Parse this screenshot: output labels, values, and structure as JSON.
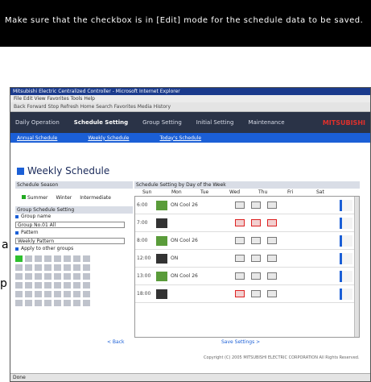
{
  "callout": {
    "text": "Make sure that the checkbox is in [Edit] mode for the schedule data to be saved."
  },
  "side_letters": [
    "a",
    "p"
  ],
  "window": {
    "title": "Mitsubishi Electric Centralized Controller - Microsoft Internet Explorer",
    "menubar": "File  Edit  View  Favorites  Tools  Help",
    "toolbar": "Back  Forward  Stop  Refresh  Home  Search  Favorites  Media  History"
  },
  "nav": {
    "items": [
      "Daily Operation",
      "Schedule Setting",
      "Group Setting",
      "Initial Setting",
      "Maintenance"
    ],
    "active": 1,
    "logo": "MITSUBISHI"
  },
  "subnav": {
    "links": [
      "Annual Schedule",
      "Weekly Schedule",
      "Today's Schedule"
    ]
  },
  "page_title": "Weekly Schedule",
  "left": {
    "season_header": "Schedule Season",
    "options": [
      "Summer",
      "Winter",
      "Intermediate"
    ],
    "group_header": "Group Schedule Setting",
    "group_label": "Group name",
    "group_value": "Group No.01 All",
    "pattern_label": "Pattern",
    "pattern_value": "Weekly Pattern",
    "copy_label": "Apply to other groups"
  },
  "right": {
    "header": "Schedule Setting by Day of the Week",
    "days": [
      "Sun",
      "Mon",
      "Tue",
      "Wed",
      "Thu",
      "Fri",
      "Sat"
    ],
    "schedule_rows": [
      {
        "event": "6:00",
        "unit": "green",
        "value": "ON  Cool  26",
        "boxes": [
          "",
          "",
          ""
        ]
      },
      {
        "event": "7:00",
        "unit": "dark",
        "value": "",
        "boxes": [
          "red",
          "red",
          "red"
        ]
      },
      {
        "event": "8:00",
        "unit": "green",
        "value": "ON  Cool  26",
        "boxes": [
          "",
          "",
          ""
        ]
      },
      {
        "event": "12:00",
        "unit": "dark",
        "value": "ON",
        "boxes": [
          "",
          "",
          ""
        ]
      },
      {
        "event": "13:00",
        "unit": "green",
        "value": "ON  Cool  26",
        "boxes": [
          "",
          "",
          ""
        ]
      },
      {
        "event": "18:00",
        "unit": "dark",
        "value": "",
        "boxes": [
          "red",
          "",
          ""
        ]
      }
    ]
  },
  "footer": {
    "prev": "< Back",
    "save": "Save Settings >",
    "copyright": "Copyright (C) 2005 MITSUBISHI ELECTRIC CORPORATION All Rights Reserved."
  },
  "status": "Done"
}
